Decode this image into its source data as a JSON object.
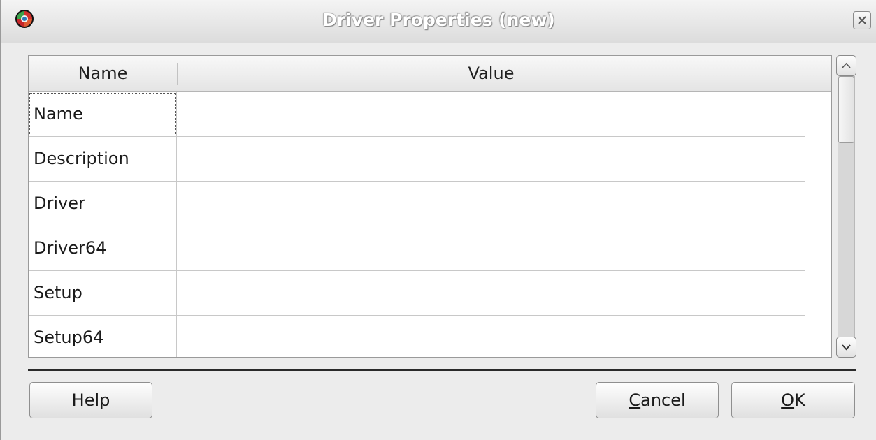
{
  "window": {
    "title": "Driver Properties (new)"
  },
  "icons": {
    "app": "odbc-app-icon",
    "close": "close-icon",
    "scroll_up": "chevron-up-icon",
    "scroll_down": "chevron-down-icon"
  },
  "table": {
    "headers": [
      "Name",
      "Value"
    ],
    "rows": [
      {
        "name": "Name",
        "value": ""
      },
      {
        "name": "Description",
        "value": ""
      },
      {
        "name": "Driver",
        "value": ""
      },
      {
        "name": "Driver64",
        "value": ""
      },
      {
        "name": "Setup",
        "value": ""
      },
      {
        "name": "Setup64",
        "value": ""
      }
    ]
  },
  "buttons": {
    "help": "Help",
    "cancel": {
      "mnemonic": "C",
      "rest": "ancel"
    },
    "ok": {
      "mnemonic": "O",
      "rest": "K"
    }
  },
  "colors": {
    "title_text": "#ffffff",
    "window_bg": "#ececec"
  }
}
